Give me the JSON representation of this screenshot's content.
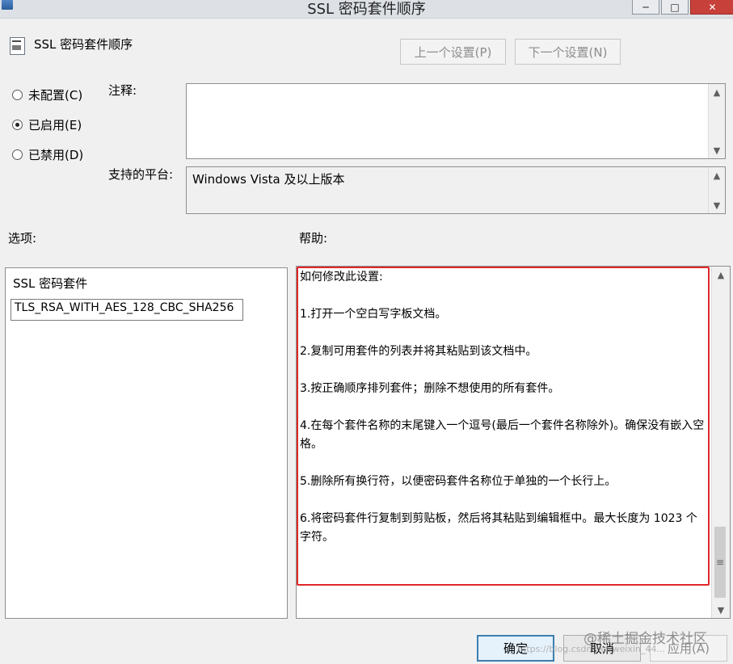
{
  "window": {
    "title": "SSL 密码套件顺序",
    "controls": [
      "─",
      "□",
      "✕"
    ]
  },
  "header": {
    "icon": "policy-setting-icon",
    "title": "SSL 密码套件顺序",
    "prev_label": "上一个设置(P)",
    "next_label": "下一个设置(N)"
  },
  "state": {
    "selected": "enabled",
    "options": [
      {
        "id": "not_configured",
        "label": "未配置(C)"
      },
      {
        "id": "enabled",
        "label": "已启用(E)"
      },
      {
        "id": "disabled",
        "label": "已禁用(D)"
      }
    ]
  },
  "comment": {
    "label": "注释:",
    "value": ""
  },
  "platform": {
    "label": "支持的平台:",
    "value": "Windows Vista 及以上版本"
  },
  "options_panel": {
    "label": "选项:",
    "title": "SSL 密码套件",
    "value": "TLS_RSA_WITH_AES_128_CBC_SHA256"
  },
  "help_panel": {
    "label": "帮助:",
    "paragraphs": [
      "如何修改此设置:",
      "1.打开一个空白写字板文档。",
      "2.复制可用套件的列表并将其粘贴到该文档中。",
      "3.按正确顺序排列套件；删除不想使用的所有套件。",
      "4.在每个套件名称的末尾键入一个逗号(最后一个套件名称除外)。确保没有嵌入空格。",
      "5.删除所有换行符，以便密码套件名称位于单独的一个长行上。",
      "6.将密码套件行复制到剪贴板，然后将其粘贴到编辑框中。最大长度为 1023 个字符。"
    ]
  },
  "buttons": {
    "ok": "确定",
    "cancel": "取消",
    "apply": "应用(A)"
  },
  "watermark": {
    "main": "@稀土掘金技术社区",
    "sub": "https://blog.csdn.net/weixin_44..."
  },
  "colors": {
    "highlight": "#e0272a",
    "default_button_border": "#3c7fb1"
  }
}
